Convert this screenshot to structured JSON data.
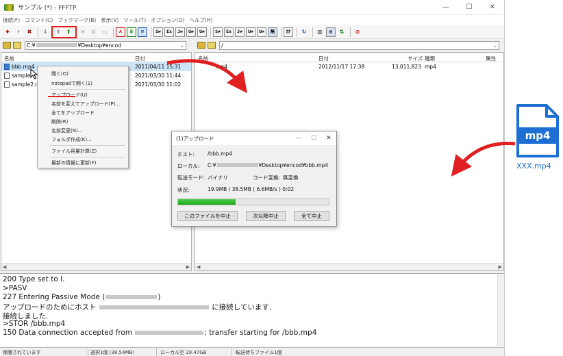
{
  "window": {
    "title": "サンプル (*) - FFFTP",
    "minimize": "—",
    "maximize": "☐",
    "close": "✕"
  },
  "menu": [
    "接続(F)",
    "コマンド(C)",
    "ブックマーク(B)",
    "表示(V)",
    "ツール(T)",
    "オプション(O)",
    "ヘルプ(H)"
  ],
  "toolbar": {
    "binary_label": "S⇄",
    "text_label": "Ex",
    "upper_label": "J⇄",
    "case_label": "U⇄",
    "cut_label": "ｶﾅ",
    "reload_icon": "refresh-icon"
  },
  "local": {
    "path_prefix": "C:¥",
    "path_suffix": "¥Desktop¥encod",
    "col_name": "名前",
    "col_date": "日付",
    "files": [
      {
        "name": "bbb.mp4",
        "date": "2011/04/11 15:31"
      },
      {
        "name": "sample",
        "date": "2021/03/30 11:44"
      },
      {
        "name": "sample2.m",
        "date": "2021/03/30 11:02"
      }
    ]
  },
  "remote": {
    "path": "/",
    "col_name": "名前",
    "col_date": "日付",
    "col_size": "サイズ",
    "col_type": "種類",
    "col_attr": "属性",
    "files": [
      {
        "name": "mp4",
        "date": "2012/11/17 17:38",
        "size": "13,011,823",
        "type": "mp4"
      }
    ]
  },
  "context_menu": {
    "open": "開く(O)",
    "open_notepad": "notepadで開く(1)",
    "upload": "アップロード(U)",
    "upload_rename": "名前を変えてアップロード(P)...",
    "upload_all": "全てをアップロード",
    "delete": "削除(R)",
    "rename": "名前変更(N)...",
    "mkdir": "フォルダ作成(K)...",
    "calc_size": "ファイル容量計算(Z)",
    "refresh": "最新の情報に更新(F)"
  },
  "dialog": {
    "title": "(1)アップロード",
    "host_label": "ホスト:",
    "host_value": "/bbb.mp4",
    "local_label": "ローカル:",
    "local_prefix": "C:¥",
    "local_suffix": "¥Desktop¥encod¥bbb.mp4",
    "mode_label": "転送モード:",
    "mode_value": "バイナリ",
    "code_label": "コード変換:",
    "code_value": "無変換",
    "status_label": "状況:",
    "status_value": "19.9MB / 38.5MB ( 6.6MB/s ) 0:02",
    "progress": 0.38,
    "btn_stop_file": "このファイルを中止",
    "btn_stop_next": "次以降中止",
    "btn_stop_all": "全て中止"
  },
  "log": {
    "l1": "200 Type set to I.",
    "l2": ">PASV",
    "l3a": "227 Entering Passive Mode (",
    "l3b": ")",
    "l4a": "アップロードのためにホスト",
    "l4b": "に接続しています.",
    "l5": "接続しました.",
    "l6": ">STOR /bbb.mp4",
    "l7a": "150 Data connection accepted from",
    "l7b": "; transfer starting for /bbb.mp4"
  },
  "status": {
    "s1": "保護されています",
    "s2": "選択1個 (38.54MB)",
    "s3": "ローカル空 20.47GB",
    "s4": "転送待ちファイル1個"
  },
  "mp4_file": {
    "badge": "mp4",
    "name": "XXX.mp4"
  },
  "colors": {
    "accent_red": "#e02020",
    "file_blue": "#1d6fd4",
    "progress_green": "#2fbf2f"
  }
}
